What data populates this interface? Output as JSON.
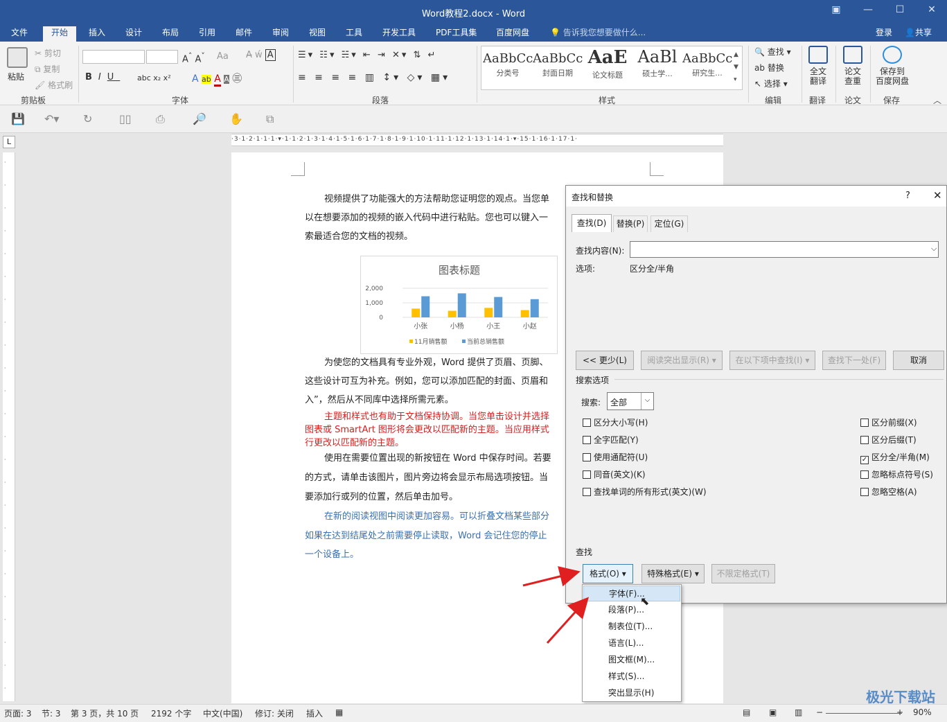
{
  "window": {
    "title": "Word教程2.docx - Word"
  },
  "tabs": [
    "文件",
    "开始",
    "插入",
    "设计",
    "布局",
    "引用",
    "邮件",
    "审阅",
    "视图",
    "工具",
    "开发工具",
    "PDF工具集",
    "百度网盘"
  ],
  "tell_me": "告诉我您想要做什么...",
  "account": {
    "login": "登录",
    "share": "共享"
  },
  "ribbon": {
    "clipboard": {
      "paste": "粘贴",
      "cut": "剪切",
      "copy": "复制",
      "painter": "格式刷",
      "label": "剪贴板"
    },
    "font": {
      "label": "字体"
    },
    "paragraph": {
      "label": "段落"
    },
    "styles": {
      "label": "样式",
      "items": [
        {
          "preview": "AaBbCc",
          "name": "分类号"
        },
        {
          "preview": "AaBbCc",
          "name": "封面日期"
        },
        {
          "preview": "AaE",
          "name": "论文标题"
        },
        {
          "preview": "AaBl",
          "name": "硕士学..."
        },
        {
          "preview": "AaBbCc",
          "name": "研究生..."
        }
      ]
    },
    "editing": {
      "find": "查找",
      "replace": "替换",
      "select": "选择",
      "label": "编辑"
    },
    "translate": {
      "btn": "全文\n翻译",
      "label": "翻译"
    },
    "paper": {
      "btn": "论文\n查重",
      "label": "论文"
    },
    "save": {
      "btn": "保存到\n百度网盘",
      "label": "保存"
    }
  },
  "doc": {
    "p1": [
      "视频提供了功能强大的方法帮助您证明您的观点。当您单",
      "以在想要添加的视频的嵌入代码中进行粘贴。您也可以键入一",
      "索最适合您的文档的视频。"
    ],
    "p2": [
      "为使您的文档具有专业外观，Word 提供了页眉、页脚、",
      "这些设计可互为补充。例如，您可以添加匹配的封面、页眉和",
      "入”，然后从不同库中选择所需元素。"
    ],
    "p3": [
      "主题和样式也有助于文档保持协调。当您单击设计并选择",
      "图表或 SmartArt 图形将会更改以匹配新的主题。当应用样式",
      "行更改以匹配新的主题。"
    ],
    "p4": [
      "使用在需要位置出现的新按钮在 Word 中保存时间。若要",
      "的方式，请单击该图片，图片旁边将会显示布局选项按钮。当",
      "要添加行或列的位置，然后单击加号。"
    ],
    "p5": [
      "在新的阅读视图中阅读更加容易。可以折叠文档某些部分",
      "如果在达到结尾处之前需要停止读取，Word 会记住您的停止",
      "一个设备上。"
    ]
  },
  "chart_data": {
    "type": "bar",
    "title": "图表标题",
    "categories": [
      "小张",
      "小杨",
      "小王",
      "小赵"
    ],
    "series": [
      {
        "name": "11月销售额",
        "color": "#ffc000",
        "values": [
          600,
          450,
          650,
          500
        ]
      },
      {
        "name": "当前总销售额",
        "color": "#5b9bd5",
        "values": [
          1450,
          1650,
          1400,
          1250
        ]
      }
    ],
    "yticks": [
      "2,000",
      "1,000",
      "0"
    ],
    "ylim": [
      0,
      2000
    ]
  },
  "dialog": {
    "title": "查找和替换",
    "help": "?",
    "tabs": [
      "查找(D)",
      "替换(P)",
      "定位(G)"
    ],
    "find_label": "查找内容(N):",
    "find_value": "",
    "options_label": "选项:",
    "options_value": "区分全/半角",
    "btn_less": "<< 更少(L)",
    "btn_highlight": "阅读突出显示(R) ▾",
    "btn_findin": "在以下项中查找(I) ▾",
    "btn_next": "查找下一处(F)",
    "btn_cancel": "取消",
    "search_options": "搜索选项",
    "search_label": "搜索:",
    "search_value": "全部",
    "left_checks": [
      {
        "label": "区分大小写(H)",
        "checked": false
      },
      {
        "label": "全字匹配(Y)",
        "checked": false
      },
      {
        "label": "使用通配符(U)",
        "checked": false
      },
      {
        "label": "同音(英文)(K)",
        "checked": false
      },
      {
        "label": "查找单词的所有形式(英文)(W)",
        "checked": false
      }
    ],
    "right_checks": [
      {
        "label": "区分前缀(X)",
        "checked": false
      },
      {
        "label": "区分后缀(T)",
        "checked": false
      },
      {
        "label": "区分全/半角(M)",
        "checked": true
      },
      {
        "label": "忽略标点符号(S)",
        "checked": false
      },
      {
        "label": "忽略空格(A)",
        "checked": false
      }
    ],
    "find_section": "查找",
    "btn_format": "格式(O) ▾",
    "btn_special": "特殊格式(E) ▾",
    "btn_noformat": "不限定格式(T)"
  },
  "menu": [
    "字体(F)...",
    "段落(P)...",
    "制表位(T)...",
    "语言(L)...",
    "图文框(M)...",
    "样式(S)...",
    "突出显示(H)"
  ],
  "status": {
    "page": "页面: 3",
    "section": "节: 3",
    "pageof": "第 3 页，共 10 页",
    "words": "2192 个字",
    "lang": "中文(中国)",
    "track": "修订: 关闭",
    "insert": "插入",
    "zoom": "90%"
  },
  "watermark": "极光下载站"
}
